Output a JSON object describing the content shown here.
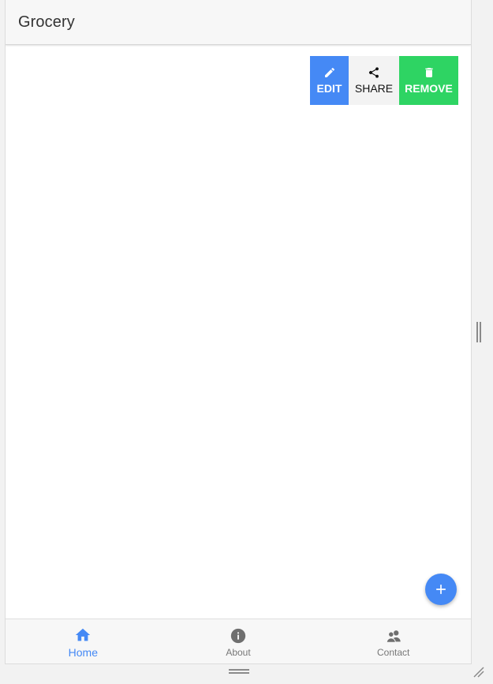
{
  "header": {
    "title": "Grocery"
  },
  "actions": {
    "edit_label": "EDIT",
    "share_label": "SHARE",
    "remove_label": "REMOVE"
  },
  "fab": {
    "icon": "plus-icon"
  },
  "tabs": [
    {
      "label": "Home",
      "icon": "home-icon",
      "active": true
    },
    {
      "label": "About",
      "icon": "info-icon",
      "active": false
    },
    {
      "label": "Contact",
      "icon": "contacts-icon",
      "active": false
    }
  ],
  "colors": {
    "accent": "#4589f5",
    "remove": "#2ed463",
    "share_bg": "#f3f3f3",
    "header_bg": "#f7f7f7",
    "inactive_tab": "#777777"
  }
}
